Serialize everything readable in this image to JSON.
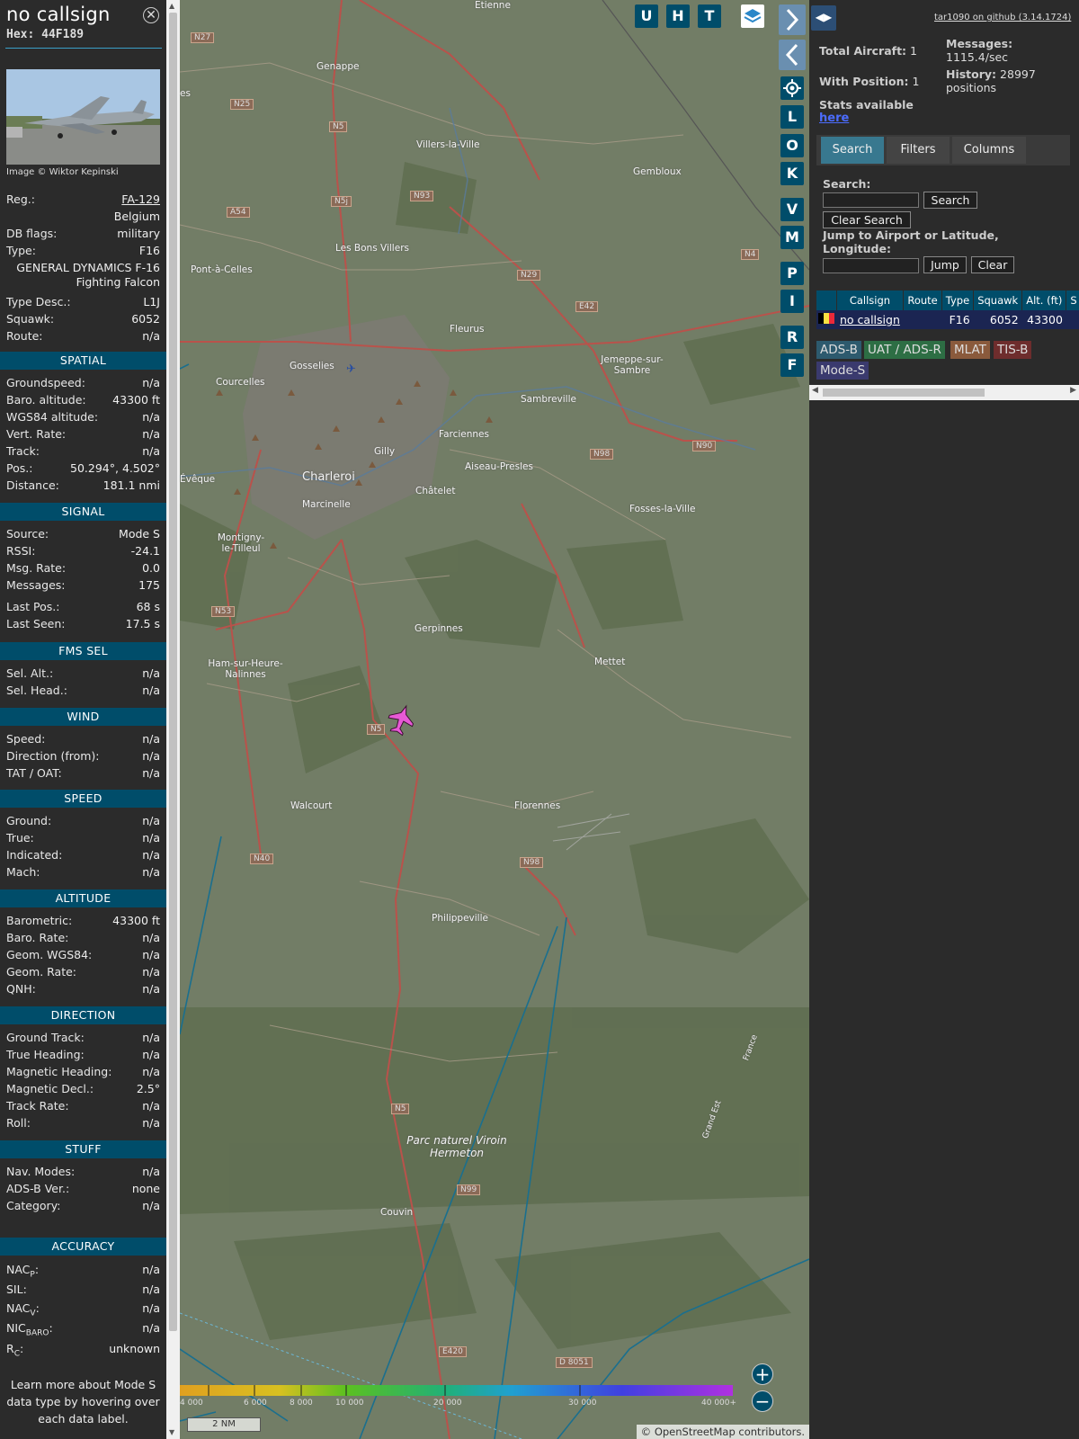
{
  "info": {
    "callsign": "no callsign",
    "hex_label": "Hex:",
    "hex": "44F189",
    "photo_credit": "Image © Wiktor Kepinski",
    "reg_label": "Reg.:",
    "reg": "FA-129",
    "country": "Belgium",
    "dbflags_label": "DB flags:",
    "dbflags": "military",
    "type_label": "Type:",
    "type": "F16",
    "type_full_1": "GENERAL DYNAMICS F-16",
    "type_full_2": "Fighting Falcon",
    "typedesc_label": "Type Desc.:",
    "typedesc": "L1J",
    "squawk_label": "Squawk:",
    "squawk": "6052",
    "route_label": "Route:",
    "route": "n/a"
  },
  "sections": {
    "spatial": "SPATIAL",
    "signal": "SIGNAL",
    "fms": "FMS SEL",
    "wind": "WIND",
    "speed": "SPEED",
    "altitude": "ALTITUDE",
    "direction": "DIRECTION",
    "stuff": "STUFF",
    "accuracy": "ACCURACY"
  },
  "spatial": [
    {
      "k": "Groundspeed:",
      "v": "n/a"
    },
    {
      "k": "Baro. altitude:",
      "v": "43300 ft"
    },
    {
      "k": "WGS84 altitude:",
      "v": "n/a"
    },
    {
      "k": "Vert. Rate:",
      "v": "n/a"
    },
    {
      "k": "Track:",
      "v": "n/a"
    },
    {
      "k": "Pos.:",
      "v": "50.294°, 4.502°"
    },
    {
      "k": "Distance:",
      "v": "181.1 nmi"
    }
  ],
  "signal": [
    {
      "k": "Source:",
      "v": "Mode S"
    },
    {
      "k": "RSSI:",
      "v": "-24.1"
    },
    {
      "k": "Msg. Rate:",
      "v": "0.0"
    },
    {
      "k": "Messages:",
      "v": "175"
    },
    {
      "k": "Last Pos.:",
      "v": "68 s"
    },
    {
      "k": "Last Seen:",
      "v": "17.5 s"
    }
  ],
  "fms": [
    {
      "k": "Sel. Alt.:",
      "v": "n/a"
    },
    {
      "k": "Sel. Head.:",
      "v": "n/a"
    }
  ],
  "wind": [
    {
      "k": "Speed:",
      "v": "n/a"
    },
    {
      "k": "Direction (from):",
      "v": "n/a"
    },
    {
      "k": "TAT / OAT:",
      "v": "n/a"
    }
  ],
  "speed": [
    {
      "k": "Ground:",
      "v": "n/a"
    },
    {
      "k": "True:",
      "v": "n/a"
    },
    {
      "k": "Indicated:",
      "v": "n/a"
    },
    {
      "k": "Mach:",
      "v": "n/a"
    }
  ],
  "altitude": [
    {
      "k": "Barometric:",
      "v": "43300 ft"
    },
    {
      "k": "Baro. Rate:",
      "v": "n/a"
    },
    {
      "k": "Geom. WGS84:",
      "v": "n/a"
    },
    {
      "k": "Geom. Rate:",
      "v": "n/a"
    },
    {
      "k": "QNH:",
      "v": "n/a"
    }
  ],
  "direction": [
    {
      "k": "Ground Track:",
      "v": "n/a"
    },
    {
      "k": "True Heading:",
      "v": "n/a"
    },
    {
      "k": "Magnetic Heading:",
      "v": "n/a"
    },
    {
      "k": "Magnetic Decl.:",
      "v": "2.5°"
    },
    {
      "k": "Track Rate:",
      "v": "n/a"
    },
    {
      "k": "Roll:",
      "v": "n/a"
    }
  ],
  "stuff": [
    {
      "k": "Nav. Modes:",
      "v": "n/a"
    },
    {
      "k": "ADS-B Ver.:",
      "v": "none"
    },
    {
      "k": "Category:",
      "v": "n/a"
    }
  ],
  "accuracy": {
    "nacp_k": "NAC",
    "nacp_sub": "P",
    "nacp_v": "n/a",
    "sil_k": "SIL:",
    "sil_v": "n/a",
    "nacv_k": "NAC",
    "nacv_sub": "V",
    "nacv_v": "n/a",
    "nic_k": "NIC",
    "nic_sub": "BARO",
    "nic_v": "n/a",
    "rc_k": "R",
    "rc_sub": "C",
    "rc_v": "unknown",
    "colon": ":"
  },
  "learn_more": "Learn more about Mode S data type by hovering over each data label.",
  "map": {
    "top_buttons": [
      "U",
      "H",
      "T"
    ],
    "side_buttons": [
      "L",
      "O",
      "K",
      "V",
      "M",
      "P",
      "I",
      "R",
      "F"
    ],
    "towns": {
      "etienne": "Etienne",
      "genappe": "Genappe",
      "villers": "Villers-la-Ville",
      "gembloux": "Gembloux",
      "bons_villers": "Les Bons Villers",
      "pont": "Pont-à-Celles",
      "fleurus": "Fleurus",
      "jemeppe": "Jemeppe-sur-Sambre",
      "gosselies": "Gosselies",
      "courcelles": "Courcelles",
      "sambreville": "Sambreville",
      "farciennes": "Farciennes",
      "gilly": "Gilly",
      "aiseau": "Aiseau-Presles",
      "charleroi": "Charleroi",
      "chatelet": "Châtelet",
      "marcinelle": "Marcinelle",
      "fosses": "Fosses-la-Ville",
      "montigny": "Montigny-le-Tilleul",
      "eveque": "Évêque",
      "gerpinnes": "Gerpinnes",
      "mettet": "Mettet",
      "ham": "Ham-sur-Heure-Nalinnes",
      "walcourt": "Walcourt",
      "florennes": "Florennes",
      "philippeville": "Philippeville",
      "parc": "Parc naturel Viroin Hermeton",
      "couvin": "Couvin",
      "france": "France",
      "grand_est": "Grand Est",
      "es": "es"
    },
    "roads": {
      "n27": "N27",
      "n25": "N25",
      "n5a": "N5",
      "n93": "N93",
      "n5j": "N5j",
      "a54": "A54",
      "n29": "N29",
      "n4": "N4",
      "e42": "E42",
      "n98a": "N98",
      "n90": "N90",
      "n53": "N53",
      "n5b": "N5",
      "n40": "N40",
      "n98b": "N98",
      "n5c": "N5",
      "n99": "N99",
      "e420": "E420",
      "d8051": "D 8051"
    },
    "altitude_ticks": [
      "4 000",
      "6 000",
      "8 000",
      "10 000",
      "20 000",
      "30 000",
      "40 000+"
    ],
    "scale": "2 NM",
    "attribution_symbol": "©",
    "attribution_link": "OpenStreetMap",
    "attribution_rest": "contributors."
  },
  "right": {
    "github": "tar1090 on github (3.14.1724)",
    "total_aircraft_label": "Total Aircraft:",
    "total_aircraft": "1",
    "with_position_label": "With Position:",
    "with_position": "1",
    "stats_label": "Stats available",
    "here": "here",
    "messages_label": "Messages:",
    "messages_rate": "1115.4/sec",
    "history_label": "History:",
    "history_count": "28997",
    "history_unit": "positions",
    "tabs": [
      "Search",
      "Filters",
      "Columns"
    ],
    "search_label": "Search:",
    "search_button": "Search",
    "clear_search_button": "Clear Search",
    "jump_label": "Jump to Airport or Latitude, Longitude:",
    "jump_button": "Jump",
    "clear_button": "Clear",
    "table_headers": [
      "Callsign",
      "Route",
      "Type",
      "Squawk",
      "Alt. (ft)",
      "S"
    ],
    "table_row": {
      "callsign": "no callsign",
      "route": "",
      "type": "F16",
      "squawk": "6052",
      "alt": "43300"
    },
    "badges": [
      "ADS-B",
      "UAT / ADS-R",
      "MLAT",
      "TIS-B",
      "Mode-S"
    ]
  },
  "colors": {
    "panel_bg": "#2b2b2b",
    "section_header": "#004d6a",
    "map_land": "#6e7a63",
    "accent_tab": "#38788f",
    "table_row_bg": "#1b2552",
    "aircraft": "#e85ad6"
  }
}
